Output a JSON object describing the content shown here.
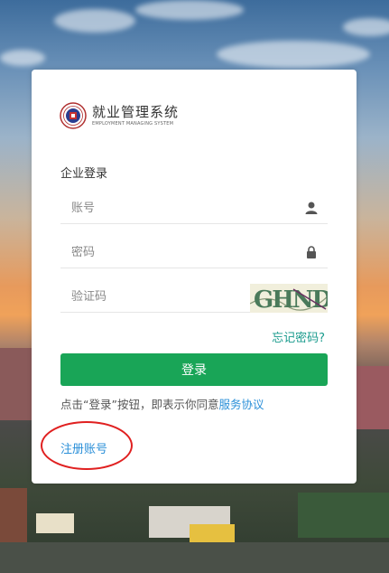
{
  "brand": {
    "title": "就业管理系统",
    "subtitle": "EMPLOYMENT MANAGING SYSTEM"
  },
  "form": {
    "section_title": "企业登录",
    "account_placeholder": "账号",
    "password_placeholder": "密码",
    "captcha_placeholder": "验证码",
    "captcha_text": "GHND",
    "forgot_label": "忘记密码?",
    "login_label": "登录",
    "agreement_prefix": "点击“登录”按钮，即表示你同意",
    "agreement_link": "服务协议",
    "register_label": "注册账号"
  },
  "colors": {
    "primary_button": "#19a557",
    "link_blue": "#2a8fd8",
    "forgot_teal": "#1a9b8d",
    "annotation_red": "#e02020"
  },
  "icons": [
    "user-icon",
    "lock-icon",
    "logo-emblem"
  ]
}
